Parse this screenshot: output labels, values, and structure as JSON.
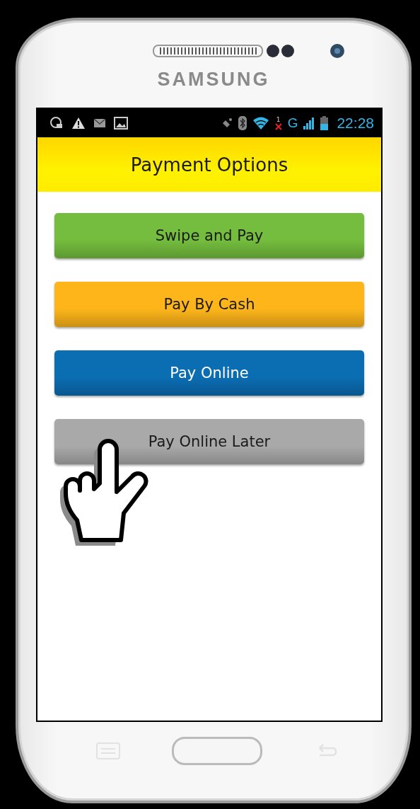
{
  "device": {
    "brand": "SAMSUNG"
  },
  "status_bar": {
    "sim_label": "1",
    "network": "G",
    "time": "22:28"
  },
  "header": {
    "title": "Payment Options"
  },
  "options": [
    {
      "label": "Swipe and Pay",
      "color": "#74bd3e"
    },
    {
      "label": "Pay By Cash",
      "color": "#fdb51a"
    },
    {
      "label": "Pay Online",
      "color": "#0b6db2"
    },
    {
      "label": "Pay Online Later",
      "color": "#a9a9a9"
    }
  ]
}
